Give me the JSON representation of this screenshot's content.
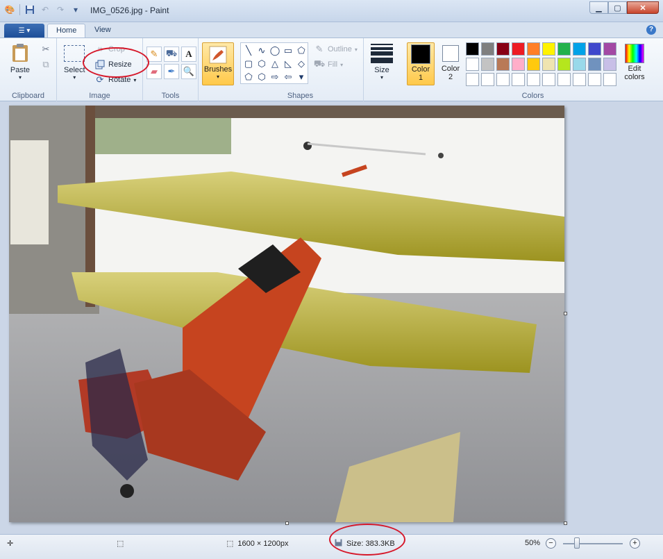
{
  "window": {
    "title": "IMG_0526.jpg - Paint",
    "minimize_icon": "minimize-icon",
    "maximize_icon": "maximize-icon",
    "close_icon": "close-icon"
  },
  "tabs": [
    {
      "label": "Home",
      "active": true
    },
    {
      "label": "View",
      "active": false
    }
  ],
  "ribbon": {
    "clipboard": {
      "group_label": "Clipboard",
      "paste_label": "Paste"
    },
    "image": {
      "group_label": "Image",
      "select_label": "Select",
      "crop_label": "Crop",
      "resize_label": "Resize",
      "rotate_label": "Rotate"
    },
    "tools": {
      "group_label": "Tools"
    },
    "brushes": {
      "label": "Brushes"
    },
    "shapes": {
      "group_label": "Shapes",
      "outline_label": "Outline",
      "fill_label": "Fill"
    },
    "size": {
      "label": "Size"
    },
    "colors": {
      "group_label": "Colors",
      "color1_label_line1": "Color",
      "color1_label_line2": "1",
      "color2_label_line1": "Color",
      "color2_label_line2": "2",
      "edit_label_line1": "Edit",
      "edit_label_line2": "colors",
      "color1": "#000000",
      "color2": "#ffffff",
      "palette": [
        "#000000",
        "#7f7f7f",
        "#880015",
        "#ed1c24",
        "#ff7f27",
        "#fff200",
        "#22b14c",
        "#00a2e8",
        "#3f48cc",
        "#a349a4",
        "#ffffff",
        "#c3c3c3",
        "#b97a57",
        "#ffaec9",
        "#ffc90e",
        "#efe4b0",
        "#b5e61d",
        "#99d9ea",
        "#7092be",
        "#c8bfe7",
        "#ffffff",
        "#ffffff",
        "#ffffff",
        "#ffffff",
        "#ffffff",
        "#ffffff",
        "#ffffff",
        "#ffffff",
        "#ffffff",
        "#ffffff"
      ]
    }
  },
  "status": {
    "dimensions": "1600 × 1200px",
    "file_size": "Size: 383.3KB",
    "zoom": "50%",
    "zoom_percent": 50
  },
  "accent": {
    "annotation_red": "#d6182a",
    "selected_orange": "#ffc94a"
  }
}
